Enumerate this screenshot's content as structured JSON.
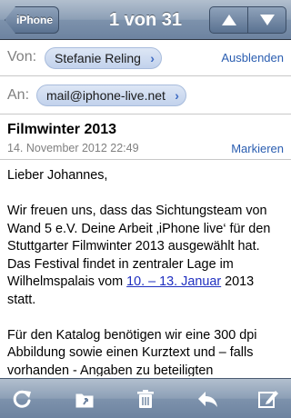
{
  "nav": {
    "back_label": "iPhone",
    "title": "1 von 31",
    "prev_icon": "up-arrow-icon",
    "next_icon": "down-arrow-icon"
  },
  "header": {
    "from_label": "Von:",
    "from_name": "Stefanie Reling",
    "hide_label": "Ausblenden",
    "to_label": "An:",
    "to_address": "mail@iphone-live.net"
  },
  "message": {
    "subject": "Filmwinter 2013",
    "date": "14. November 2012 22:49",
    "mark_label": "Markieren",
    "greeting": "Lieber Johannes,",
    "para1_before_link": "Wir freuen uns, dass das Sichtungsteam von Wand 5 e.V. Deine Arbeit ‚iPhone live‘ für den Stuttgarter Filmwinter 2013 ausgewählt hat. Das Festival findet in zentraler Lage im Wilhelmspalais vom ",
    "para1_link": "10. – 13. Januar",
    "para1_after_link": " 2013 statt.",
    "para2": "Für den Katalog benötigen wir eine 300 dpi Abbildung sowie einen Kurztext und – falls vorhanden - Angaben zu beteiligten"
  },
  "toolbar": {
    "refresh_icon": "refresh-icon",
    "move_icon": "move-to-folder-icon",
    "trash_icon": "trash-icon",
    "reply_icon": "reply-icon",
    "compose_icon": "compose-icon"
  },
  "colors": {
    "bar": "#7d92ac",
    "link": "#2a5db0",
    "chip": "#c2d2ec"
  }
}
